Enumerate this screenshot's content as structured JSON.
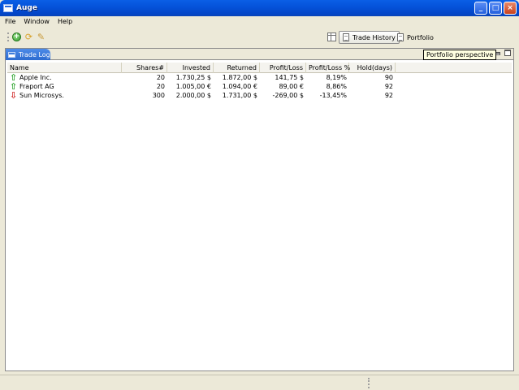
{
  "window": {
    "title": "Auge",
    "minimize": "_",
    "maximize": "□",
    "close": "×"
  },
  "menu": [
    "File",
    "Window",
    "Help"
  ],
  "toolbar": {
    "icons": [
      "add-icon",
      "sync-icon",
      "wrench-icon"
    ]
  },
  "perspectives": {
    "items": [
      {
        "label": "Trade History",
        "active": true
      },
      {
        "label": "Portfolio",
        "active": false
      }
    ]
  },
  "tooltip": "Portfolio perspective",
  "view": {
    "tab_label": "Trade Log"
  },
  "table": {
    "columns": [
      "Name",
      "Shares#",
      "Invested",
      "Returned",
      "Profit/Loss",
      "Profit/Loss %",
      "Hold(days)"
    ],
    "rows": [
      {
        "trend": "up",
        "name": "Apple Inc.",
        "shares": "20",
        "invested": "1.730,25 $",
        "returned": "1.872,00 $",
        "profit_loss": "141,75 $",
        "profit_loss_pct": "8,19%",
        "hold_days": "90"
      },
      {
        "trend": "up",
        "name": "Fraport AG",
        "shares": "20",
        "invested": "1.005,00 €",
        "returned": "1.094,00 €",
        "profit_loss": "89,00 €",
        "profit_loss_pct": "8,86%",
        "hold_days": "92"
      },
      {
        "trend": "down",
        "name": "Sun Microsys.",
        "shares": "300",
        "invested": "2.000,00 $",
        "returned": "1.731,00 $",
        "profit_loss": "-269,00 $",
        "profit_loss_pct": "-13,45%",
        "hold_days": "92"
      }
    ]
  },
  "colors": {
    "titlebar": "#0553DA",
    "up_arrow": "#2EA42E",
    "down_arrow": "#D02A2A",
    "tab_active": "#2C6BD0"
  }
}
